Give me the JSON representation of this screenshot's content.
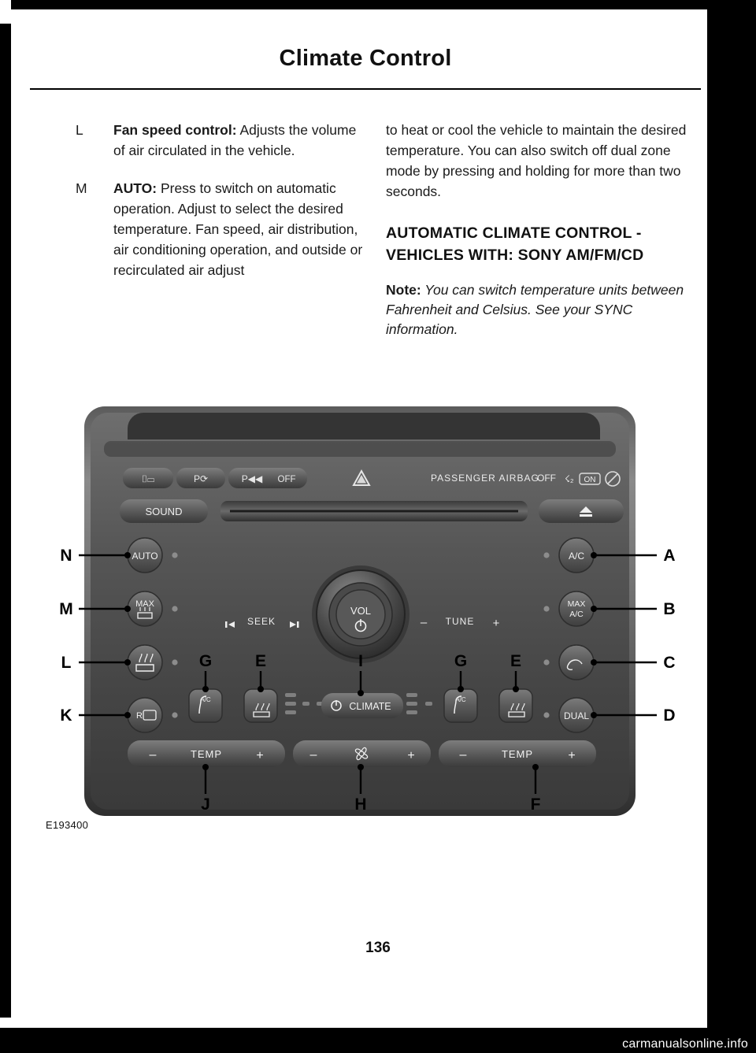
{
  "document": {
    "header_title": "Climate Control",
    "page_number": "136",
    "figure_caption": "E193400",
    "watermark": "carmanualsonline.info"
  },
  "left_column": {
    "items": [
      {
        "letter": "L",
        "bold_label": "Fan speed control:",
        "text": " Adjusts the volume of air circulated in the vehicle."
      },
      {
        "letter": "M",
        "bold_label": "AUTO:",
        "text": " Press to switch on automatic operation. Adjust to select the desired temperature. Fan speed, air distribution, air conditioning operation, and outside or recirculated air adjust"
      }
    ]
  },
  "right_column": {
    "continuation": "to heat or cool the vehicle to maintain the desired temperature. You can also switch off dual zone mode by pressing and holding for more than two seconds.",
    "section_heading": "AUTOMATIC CLIMATE CONTROL - VEHICLES WITH: SONY AM/FM/CD",
    "note_label": "Note:",
    "note_text": " You can switch temperature units between Fahrenheit and Celsius. See your SYNC information."
  },
  "figure": {
    "callouts_left": [
      "N",
      "M",
      "L",
      "K"
    ],
    "callouts_right": [
      "A",
      "B",
      "C",
      "D"
    ],
    "callouts_inner": [
      "G",
      "E",
      "I",
      "G",
      "E"
    ],
    "callouts_bottom": [
      "J",
      "H",
      "F"
    ],
    "panel_labels": {
      "passenger_airbag": "PASSENGER AIRBAG",
      "airbag_off": "OFF",
      "airbag_on": "ON",
      "sound": "SOUND",
      "park_off": "OFF",
      "seek": "SEEK",
      "vol": "VOL",
      "tune": "TUNE",
      "climate": "CLIMATE",
      "temp_left": "TEMP",
      "temp_right": "TEMP",
      "auto": "AUTO",
      "max_defrost": "MAX",
      "ac": "A/C",
      "max_ac_line1": "MAX",
      "max_ac_line2": "A/C",
      "dual": "DUAL",
      "minus": "–",
      "plus": "+"
    }
  }
}
